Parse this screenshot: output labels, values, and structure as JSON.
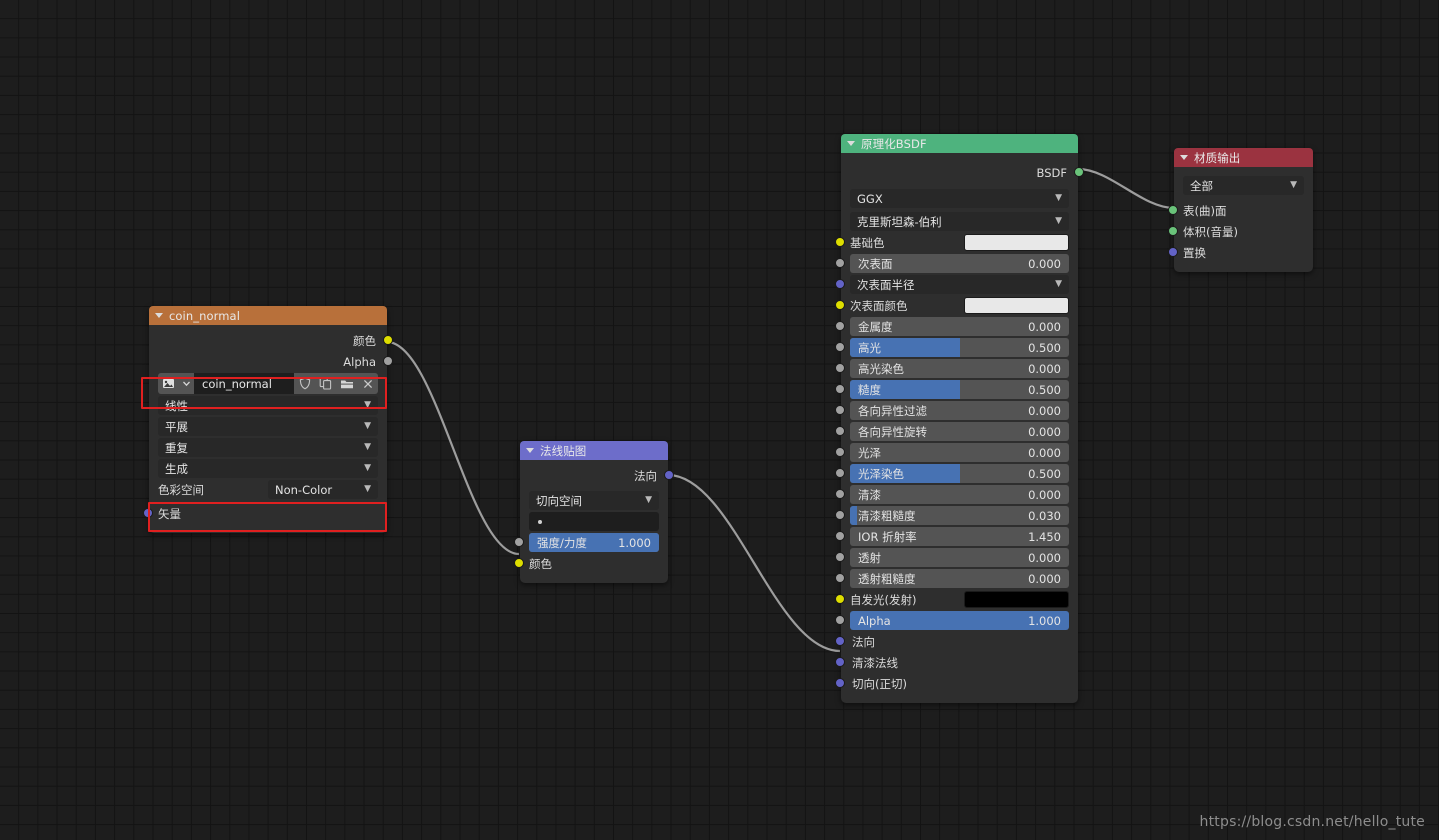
{
  "app": {
    "editor": "shader-node-editor",
    "watermark": "https://blog.csdn.net/hello_tute"
  },
  "colors": {
    "header_texture": "#b8703a",
    "header_normalmap": "#6d6dca",
    "header_bsdf": "#4eb37e",
    "header_output": "#9b3340",
    "slider_fill": "#4772b3",
    "highlight_box": "#e02020",
    "socket_color": "#dede00",
    "socket_value": "#a1a1a1",
    "socket_vector": "#6363c7",
    "socket_shader": "#6ac37a"
  },
  "nodes": {
    "image_texture": {
      "title": "coin_normal",
      "outputs": [
        {
          "label": "颜色",
          "socket": "color"
        },
        {
          "label": "Alpha",
          "socket": "value"
        }
      ],
      "datablock": {
        "name": "coin_normal",
        "icons": [
          "image-icon",
          "browse-chevron-icon",
          "fake-user-shield-icon",
          "duplicate-icon",
          "open-folder-icon",
          "unlink-x-icon"
        ]
      },
      "dropdowns": [
        "线性",
        "平展",
        "重复",
        "生成"
      ],
      "colorspace": {
        "label": "色彩空间",
        "value": "Non-Color"
      },
      "inputs": [
        {
          "label": "矢量",
          "socket": "vector"
        }
      ]
    },
    "normal_map": {
      "title": "法线贴图",
      "outputs": [
        {
          "label": "法向",
          "socket": "vector"
        }
      ],
      "space": "切向空间",
      "uv_map": "",
      "strength": {
        "label": "强度/力度",
        "value": "1.000",
        "fill": 100
      },
      "inputs": [
        {
          "label": "颜色",
          "socket": "color"
        }
      ]
    },
    "principled_bsdf": {
      "title": "原理化BSDF",
      "outputs": [
        {
          "label": "BSDF",
          "socket": "shader"
        }
      ],
      "distribution": "GGX",
      "subsurface_method": "克里斯坦森-伯利",
      "properties": [
        {
          "label": "基础色",
          "kind": "color",
          "color": "#e8e8e8",
          "socket": "color"
        },
        {
          "label": "次表面",
          "kind": "slider",
          "value": "0.000",
          "fill": 0,
          "socket": "value"
        },
        {
          "label": "次表面半径",
          "kind": "dropdown",
          "socket": "vector"
        },
        {
          "label": "次表面颜色",
          "kind": "color",
          "color": "#e8e8e8",
          "socket": "color"
        },
        {
          "label": "金属度",
          "kind": "slider",
          "value": "0.000",
          "fill": 0,
          "socket": "value"
        },
        {
          "label": "高光",
          "kind": "slider",
          "value": "0.500",
          "fill": 50,
          "socket": "value"
        },
        {
          "label": "高光染色",
          "kind": "slider",
          "value": "0.000",
          "fill": 0,
          "socket": "value"
        },
        {
          "label": "糙度",
          "kind": "slider",
          "value": "0.500",
          "fill": 50,
          "socket": "value"
        },
        {
          "label": "各向异性过滤",
          "kind": "slider",
          "value": "0.000",
          "fill": 0,
          "socket": "value"
        },
        {
          "label": "各向异性旋转",
          "kind": "slider",
          "value": "0.000",
          "fill": 0,
          "socket": "value"
        },
        {
          "label": "光泽",
          "kind": "slider",
          "value": "0.000",
          "fill": 0,
          "socket": "value"
        },
        {
          "label": "光泽染色",
          "kind": "slider",
          "value": "0.500",
          "fill": 50,
          "socket": "value"
        },
        {
          "label": "清漆",
          "kind": "slider",
          "value": "0.000",
          "fill": 0,
          "socket": "value"
        },
        {
          "label": "清漆粗糙度",
          "kind": "slider",
          "value": "0.030",
          "fill": 3,
          "socket": "value"
        },
        {
          "label": "IOR 折射率",
          "kind": "slider",
          "value": "1.450",
          "fill": 0,
          "socket": "value"
        },
        {
          "label": "透射",
          "kind": "slider",
          "value": "0.000",
          "fill": 0,
          "socket": "value"
        },
        {
          "label": "透射粗糙度",
          "kind": "slider",
          "value": "0.000",
          "fill": 0,
          "socket": "value"
        },
        {
          "label": "自发光(发射)",
          "kind": "color",
          "color": "#000000",
          "socket": "color"
        },
        {
          "label": "Alpha",
          "kind": "slider",
          "value": "1.000",
          "fill": 100,
          "socket": "value",
          "selected": true
        },
        {
          "label": "法向",
          "kind": "plain",
          "socket": "vector"
        },
        {
          "label": "清漆法线",
          "kind": "plain",
          "socket": "vector"
        },
        {
          "label": "切向(正切)",
          "kind": "plain",
          "socket": "vector"
        }
      ]
    },
    "material_output": {
      "title": "材质输出",
      "target": "全部",
      "inputs": [
        {
          "label": "表(曲)面",
          "socket": "shader"
        },
        {
          "label": "体积(音量)",
          "socket": "shader"
        },
        {
          "label": "置换",
          "socket": "vector"
        }
      ]
    }
  }
}
